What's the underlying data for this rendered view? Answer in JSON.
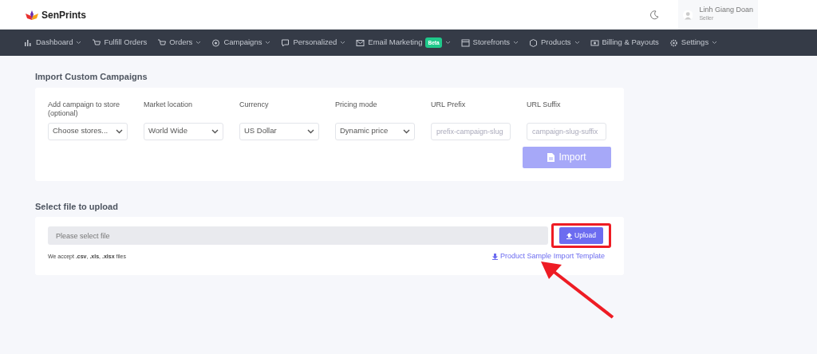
{
  "brand": {
    "name": "SenPrints"
  },
  "user": {
    "name": "Linh Giang Doan",
    "role": "Seller"
  },
  "nav": [
    {
      "label": "Dashboard",
      "dropdown": true
    },
    {
      "label": "Fulfill Orders",
      "dropdown": false
    },
    {
      "label": "Orders",
      "dropdown": true
    },
    {
      "label": "Campaigns",
      "dropdown": true
    },
    {
      "label": "Personalized",
      "dropdown": true
    },
    {
      "label": "Email Marketing",
      "badge": "Beta",
      "dropdown": true
    },
    {
      "label": "Storefronts",
      "dropdown": true
    },
    {
      "label": "Products",
      "dropdown": true
    },
    {
      "label": "Billing & Payouts",
      "dropdown": false
    },
    {
      "label": "Settings",
      "dropdown": true
    }
  ],
  "import_section": {
    "title": "Import Custom Campaigns",
    "fields": [
      {
        "kind": "select",
        "label": "Add campaign to store (optional)",
        "value": "Choose stores..."
      },
      {
        "kind": "select",
        "label": "Market location",
        "value": "World Wide"
      },
      {
        "kind": "select",
        "label": "Currency",
        "value": "US Dollar"
      },
      {
        "kind": "select",
        "label": "Pricing mode",
        "value": "Dynamic price"
      },
      {
        "kind": "text",
        "label": "URL Prefix",
        "placeholder": "prefix-campaign-slug"
      },
      {
        "kind": "text",
        "label": "URL Suffix",
        "placeholder": "campaign-slug-suffix"
      }
    ],
    "button": {
      "label": "Import",
      "disabled": true
    }
  },
  "upload_section": {
    "title": "Select file to upload",
    "placeholder": "Please select file",
    "button": {
      "label": "Upload",
      "highlighted": true
    },
    "hint": "We accept **.csv**, **.xls**, **.xlsx** files",
    "template_link": "Product Sample Import Template"
  },
  "annotation_arrow": true
}
